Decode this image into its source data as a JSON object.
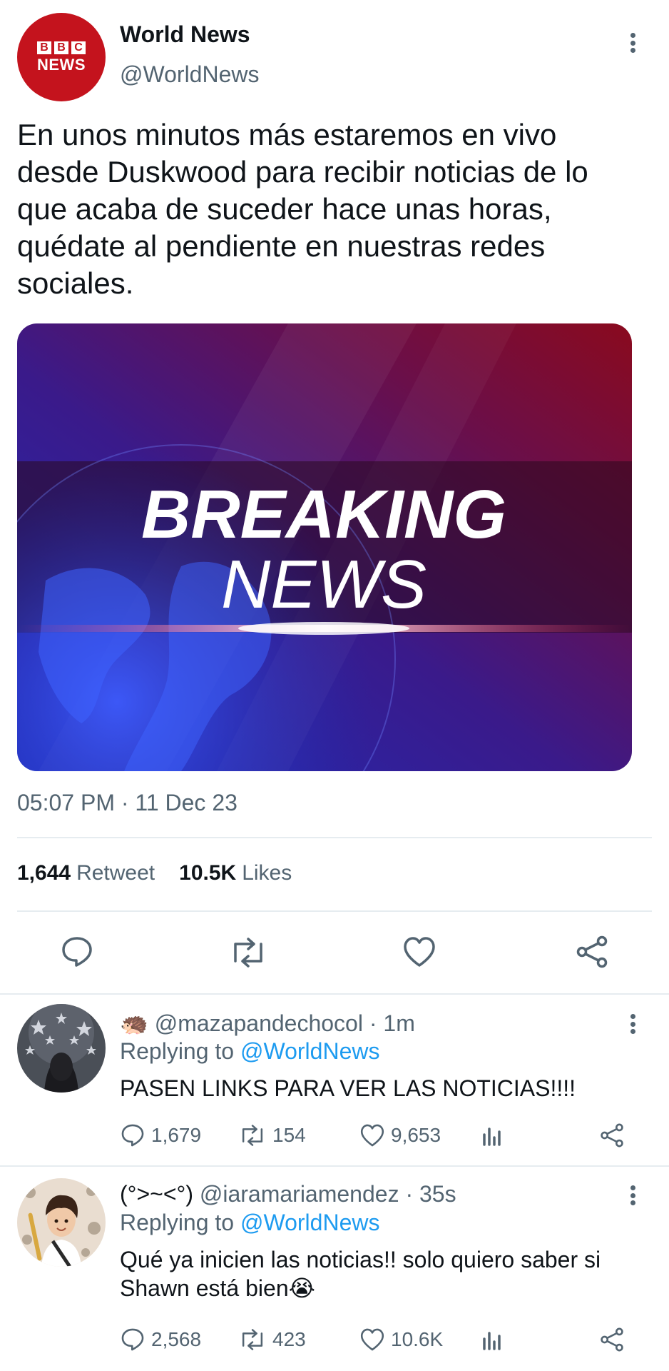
{
  "tweet": {
    "author_name": "World News",
    "author_handle": "@WorldNews",
    "avatar_logo": {
      "blocks": [
        "B",
        "B",
        "C"
      ],
      "word": "NEWS"
    },
    "text": "En unos minutos más estaremos en vivo desde Duskwood para recibir noticias de lo que acaba de suceder hace unas horas, quédate al pendiente en nuestras redes sociales.",
    "media": {
      "headline_1": "BREAKING",
      "headline_2": "NEWS"
    },
    "timestamp": "05:07 PM · 11 Dec 23",
    "retweets_count": "1,644",
    "retweets_label": "Retweet",
    "likes_count": "10.5K",
    "likes_label": "Likes",
    "actions": [
      "reply-icon",
      "retweet-icon",
      "like-icon",
      "share-icon"
    ]
  },
  "replies": [
    {
      "emoji": "🦔",
      "handle": "@mazapandechocol",
      "time": "· 1m",
      "replying_label": "Replying to",
      "replying_to": "@WorldNews",
      "text": "PASEN LINKS PARA VER LAS NOTICIAS!!!!",
      "reply_count": "1,679",
      "retweet_count": "154",
      "like_count": "9,653"
    },
    {
      "name": "(°>~<°)",
      "handle": "@iaramariamendez",
      "time": "· 35s",
      "replying_label": "Replying to",
      "replying_to": "@WorldNews",
      "text": "Qué ya inicien las noticias!! solo quiero saber si Shawn está bien😭",
      "reply_count": "2,568",
      "retweet_count": "423",
      "like_count": "10.6K"
    }
  ],
  "colors": {
    "text": "#0f1419",
    "secondary": "#536471",
    "link": "#1d9bf0",
    "bbc_red": "#c4131d",
    "divider": "#e6ecf0"
  }
}
